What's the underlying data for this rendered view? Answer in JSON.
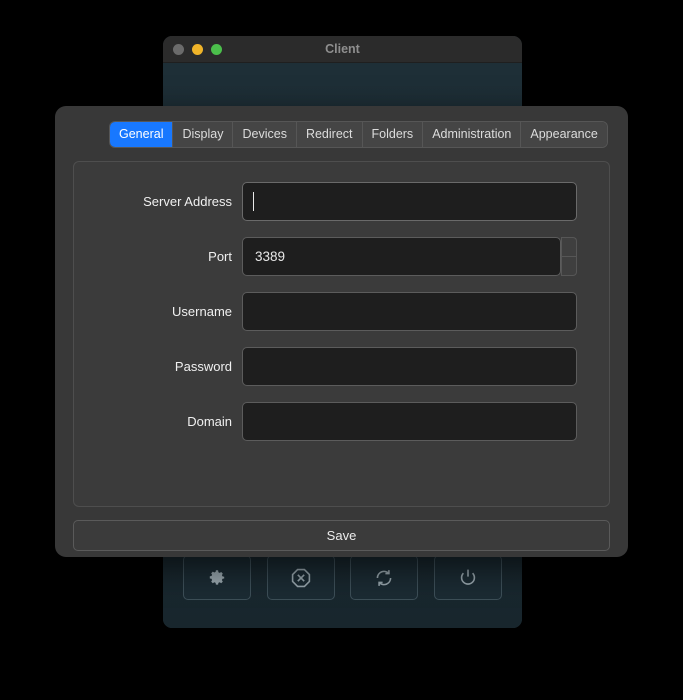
{
  "client_window": {
    "title": "Client",
    "traffic_lights": [
      {
        "name": "close",
        "color": "#6b6b6b"
      },
      {
        "name": "minimize",
        "color": "#f0b429"
      },
      {
        "name": "maximize",
        "color": "#4bbf4b"
      }
    ],
    "background_color": "#1b2b33",
    "toolbar": [
      {
        "icon": "gear-icon",
        "label": "Settings"
      },
      {
        "icon": "x-octagon-icon",
        "label": "Disconnect"
      },
      {
        "icon": "refresh-icon",
        "label": "Reconnect"
      },
      {
        "icon": "power-icon",
        "label": "Power"
      }
    ]
  },
  "dialog": {
    "accent_color": "#1878ff",
    "panel_color": "#3b3b3b",
    "field_color": "#1e1e1e",
    "tabs": [
      {
        "label": "General",
        "active": true
      },
      {
        "label": "Display",
        "active": false
      },
      {
        "label": "Devices",
        "active": false
      },
      {
        "label": "Redirect",
        "active": false
      },
      {
        "label": "Folders",
        "active": false
      },
      {
        "label": "Administration",
        "active": false
      },
      {
        "label": "Appearance",
        "active": false
      }
    ],
    "fields": [
      {
        "label": "Server Address",
        "value": "",
        "placeholder": "",
        "type": "text",
        "focused": true
      },
      {
        "label": "Port",
        "value": "3389",
        "placeholder": "",
        "type": "number",
        "focused": false
      },
      {
        "label": "Username",
        "value": "",
        "placeholder": "",
        "type": "text",
        "focused": false
      },
      {
        "label": "Password",
        "value": "",
        "placeholder": "",
        "type": "password",
        "focused": false
      },
      {
        "label": "Domain",
        "value": "",
        "placeholder": "",
        "type": "text",
        "focused": false
      }
    ],
    "save_label": "Save"
  }
}
